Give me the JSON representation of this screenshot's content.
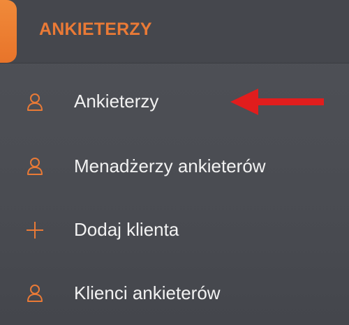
{
  "sidebar": {
    "section_title": "ANKIETERZY",
    "accent_color": "#ea7a36",
    "items": [
      {
        "label": "Ankieterzy",
        "icon": "user-icon"
      },
      {
        "label": "Menadżerzy ankieterów",
        "icon": "user-icon"
      },
      {
        "label": "Dodaj klienta",
        "icon": "plus-icon"
      },
      {
        "label": "Klienci ankieterów",
        "icon": "user-icon"
      }
    ]
  },
  "annotation": {
    "arrow_color": "#e11d1d"
  }
}
